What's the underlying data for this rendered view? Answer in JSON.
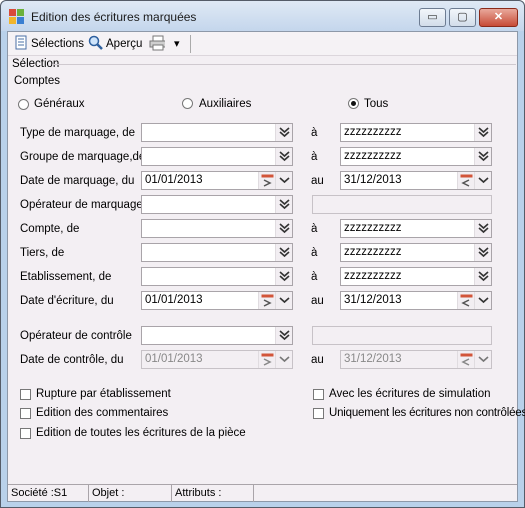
{
  "window": {
    "title": "Edition des écritures marquées",
    "controls": {
      "minimize": "▭",
      "maximize": "▢",
      "close": "✕"
    }
  },
  "toolbar": {
    "selections_label": "Sélections",
    "preview_label": "Aperçu",
    "print_icon": "printer-icon",
    "dropdown_glyph": "▾"
  },
  "section": {
    "label": "Sélection"
  },
  "accounts": {
    "label": "Comptes",
    "options": [
      {
        "label": "Généraux",
        "selected": false
      },
      {
        "label": "Auxiliaires",
        "selected": false
      },
      {
        "label": "Tous",
        "selected": true
      }
    ]
  },
  "rows": {
    "type_marquage": {
      "label": "Type de marquage, de",
      "from": "",
      "sep": "à",
      "to": "zzzzzzzzzz"
    },
    "groupe_marquage": {
      "label": "Groupe de marquage,de",
      "from": "",
      "sep": "à",
      "to": "zzzzzzzzzz"
    },
    "date_marquage": {
      "label": "Date de marquage, du",
      "from": "01/01/2013",
      "sep": "au",
      "to": "31/12/2013"
    },
    "operateur_marquage": {
      "label": "Opérateur de marquage",
      "value": "",
      "extra": ""
    },
    "compte": {
      "label": "Compte, de",
      "from": "",
      "sep": "à",
      "to": "zzzzzzzzzz"
    },
    "tiers": {
      "label": "Tiers, de",
      "from": "",
      "sep": "à",
      "to": "zzzzzzzzzz"
    },
    "etablissement": {
      "label": "Etablissement, de",
      "from": "",
      "sep": "à",
      "to": "zzzzzzzzzz"
    },
    "date_ecriture": {
      "label": "Date d'écriture, du",
      "from": "01/01/2013",
      "sep": "au",
      "to": "31/12/2013"
    },
    "operateur_controle": {
      "label": "Opérateur de contrôle",
      "value": "",
      "extra": ""
    },
    "date_controle": {
      "label": "Date de contrôle, du",
      "from": "01/01/2013",
      "sep": "au",
      "to": "31/12/2013"
    }
  },
  "checkboxes": {
    "rupture": {
      "label": "Rupture par établissement",
      "checked": false
    },
    "commentaires": {
      "label": "Edition des commentaires",
      "checked": false
    },
    "toutes": {
      "label": "Edition de toutes les écritures de la pièce",
      "checked": false
    },
    "simulation": {
      "label": "Avec les écritures de simulation",
      "checked": false
    },
    "non_controlees": {
      "label": "Uniquement les écritures non contrôlées",
      "checked": false
    }
  },
  "status": {
    "societe": "Société :S1",
    "objet": "Objet :",
    "attributs": "Attributs :"
  },
  "colors": {
    "title_bar": "#c4d6ec",
    "client_bg": "#f3eff3",
    "close_button": "#c74b36",
    "calendar_accent": "#d2553a"
  }
}
